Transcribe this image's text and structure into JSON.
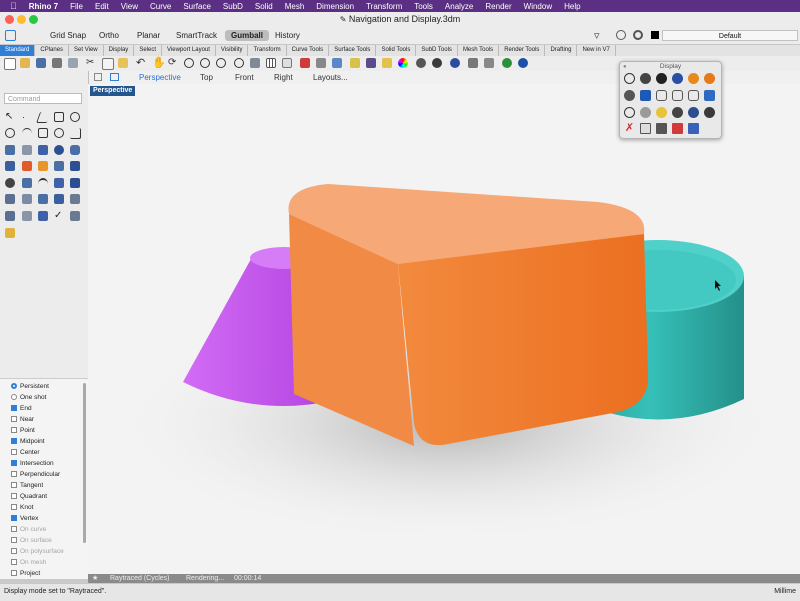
{
  "menubar": {
    "items": [
      "Rhino 7",
      "File",
      "Edit",
      "View",
      "Curve",
      "Surface",
      "SubD",
      "Solid",
      "Mesh",
      "Dimension",
      "Transform",
      "Tools",
      "Analyze",
      "Render",
      "Window",
      "Help"
    ]
  },
  "window": {
    "title": "Navigation and Display.3dm"
  },
  "toolbar": {
    "modes": [
      "Grid Snap",
      "Ortho",
      "Planar",
      "SmartTrack",
      "Gumball",
      "History"
    ],
    "layer": "Default"
  },
  "tabs": [
    "Standard",
    "CPlanes",
    "Set View",
    "Display",
    "Select",
    "Viewport Layout",
    "Visibility",
    "Transform",
    "Curve Tools",
    "Surface Tools",
    "Solid Tools",
    "SubD Tools",
    "Mesh Tools",
    "Render Tools",
    "Drafting",
    "New in V7"
  ],
  "viewport_tabs": [
    "Perspective",
    "Top",
    "Front",
    "Right",
    "Layouts..."
  ],
  "command": {
    "placeholder": "Command"
  },
  "viewport": {
    "label": "Perspective"
  },
  "display_panel": {
    "title": "Display"
  },
  "osnap": {
    "items": [
      {
        "label": "Persistent",
        "state": "radio-on"
      },
      {
        "label": "One shot",
        "state": "radio-off"
      },
      {
        "label": "End",
        "state": "on"
      },
      {
        "label": "Near",
        "state": "off"
      },
      {
        "label": "Point",
        "state": "off"
      },
      {
        "label": "Midpoint",
        "state": "on"
      },
      {
        "label": "Center",
        "state": "off"
      },
      {
        "label": "Intersection",
        "state": "on"
      },
      {
        "label": "Perpendicular",
        "state": "off"
      },
      {
        "label": "Tangent",
        "state": "off"
      },
      {
        "label": "Quadrant",
        "state": "off"
      },
      {
        "label": "Knot",
        "state": "off"
      },
      {
        "label": "Vertex",
        "state": "on"
      },
      {
        "label": "On curve",
        "state": "disabled"
      },
      {
        "label": "On surface",
        "state": "disabled"
      },
      {
        "label": "On polysurface",
        "state": "disabled"
      },
      {
        "label": "On mesh",
        "state": "disabled"
      },
      {
        "label": "Project",
        "state": "off"
      }
    ]
  },
  "render_status": {
    "mode": "Raytraced (Cycles)",
    "status": "Rendering...",
    "time": "00:00:14"
  },
  "statusbar": {
    "message": "Display mode set to \"Raytraced\".",
    "units": "Millime"
  },
  "colors": {
    "menubar": "#5b2f83",
    "accent": "#2d7fd8",
    "box": "#f07a2f",
    "cone": "#bf4fe6",
    "cylinder": "#30b3ad"
  }
}
